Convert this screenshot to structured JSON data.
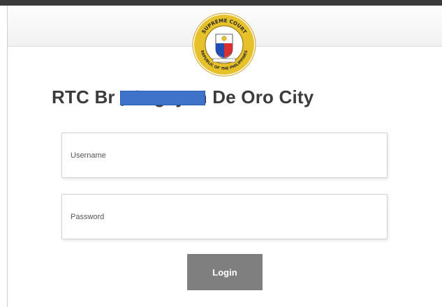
{
  "seal": {
    "top_text": "SUPREME COURT",
    "bottom_text": "REPUBLIC OF THE PHILIPPINES"
  },
  "header": {
    "title": "RTC Br          , Cagayan De Oro City"
  },
  "form": {
    "username_placeholder": "Username",
    "username_value": "",
    "password_placeholder": "Password",
    "password_value": "",
    "login_label": "Login"
  },
  "colors": {
    "button": "#7f7f7f",
    "redaction": "#3f72c9",
    "title": "#3c3c3c",
    "seal_gold": "#e6c12a"
  }
}
